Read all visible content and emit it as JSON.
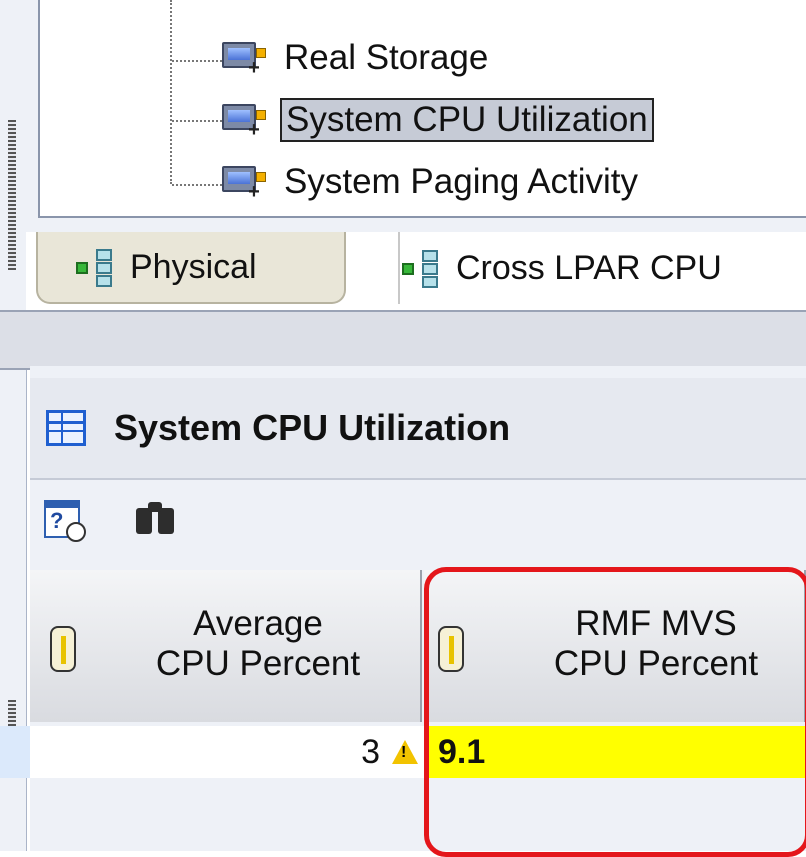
{
  "tree": {
    "items": [
      {
        "label": "Real Storage",
        "selected": false
      },
      {
        "label": "System CPU Utilization",
        "selected": true
      },
      {
        "label": "System Paging Activity",
        "selected": false
      }
    ]
  },
  "tabs": [
    {
      "label": "Physical",
      "active": true,
      "icon": "network-icon"
    },
    {
      "label": "Cross LPAR CPU",
      "active": false,
      "icon": "network-icon"
    }
  ],
  "workspace": {
    "title": "System CPU Utilization",
    "title_icon": "table-icon",
    "toolbar": [
      "calendar-history-icon",
      "binoculars-icon"
    ]
  },
  "table": {
    "columns": [
      {
        "line1": "Average",
        "line2": "CPU Percent",
        "icon": "thermometer-icon"
      },
      {
        "line1": "RMF MVS",
        "line2": "CPU Percent",
        "icon": "thermometer-icon"
      }
    ],
    "rows": [
      {
        "avg_cpu": "3",
        "avg_status": "warning",
        "rmf_cpu": "9.1",
        "rmf_highlight": "#ffff00"
      }
    ]
  },
  "colors": {
    "highlight_box": "#e4161b",
    "cell_highlight": "#ffff00",
    "selection_bg": "#c6cbd6"
  }
}
